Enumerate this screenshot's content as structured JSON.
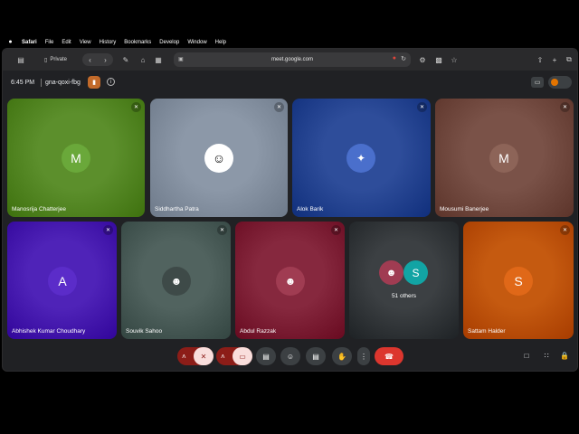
{
  "menubar": {
    "apple_icon": "",
    "items": [
      "Safari",
      "File",
      "Edit",
      "View",
      "History",
      "Bookmarks",
      "Develop",
      "Window",
      "Help"
    ]
  },
  "browser": {
    "private_label": "Private",
    "url": "meet.google.com"
  },
  "meeting": {
    "time": "6:45 PM",
    "code": "gna-qoxi-fbg"
  },
  "participants": [
    {
      "name": "Manosrija Chatterjee",
      "initial": "M",
      "bg": "#5c8f2c",
      "avatar_color": "#6aa83a"
    },
    {
      "name": "Siddhartha Patra",
      "initial": "",
      "bg": "#8c98a8",
      "avatar_color": "#ffffff"
    },
    {
      "name": "Alok Barik",
      "initial": "",
      "bg": "#2e4d9a",
      "avatar_color": "#4a6fcc"
    },
    {
      "name": "Mousumi Banerjee",
      "initial": "M",
      "bg": "#7a5248",
      "avatar_color": "#8d6458"
    },
    {
      "name": "Abhishek Kumar Choudhary",
      "initial": "A",
      "bg": "#4f23b8",
      "avatar_color": "#5b2cc9"
    },
    {
      "name": "Souvik Sahoo",
      "initial": "",
      "bg": "#51635f",
      "avatar_color": "#3e4a48"
    },
    {
      "name": "Abdul Razzak",
      "initial": "",
      "bg": "#86283e",
      "avatar_color": "#a03c52"
    },
    {
      "name": "51 others",
      "initial": "S",
      "bg": "#3c4043",
      "avatar_color": "#12a4a4"
    },
    {
      "name": "Sattam Halder",
      "initial": "S",
      "bg": "#c55a10",
      "avatar_color": "#e06818"
    }
  ],
  "controls": {
    "mic_icon": "mic-off-icon",
    "camera_icon": "camera-off-icon",
    "hangup_icon": "call-end-icon"
  }
}
